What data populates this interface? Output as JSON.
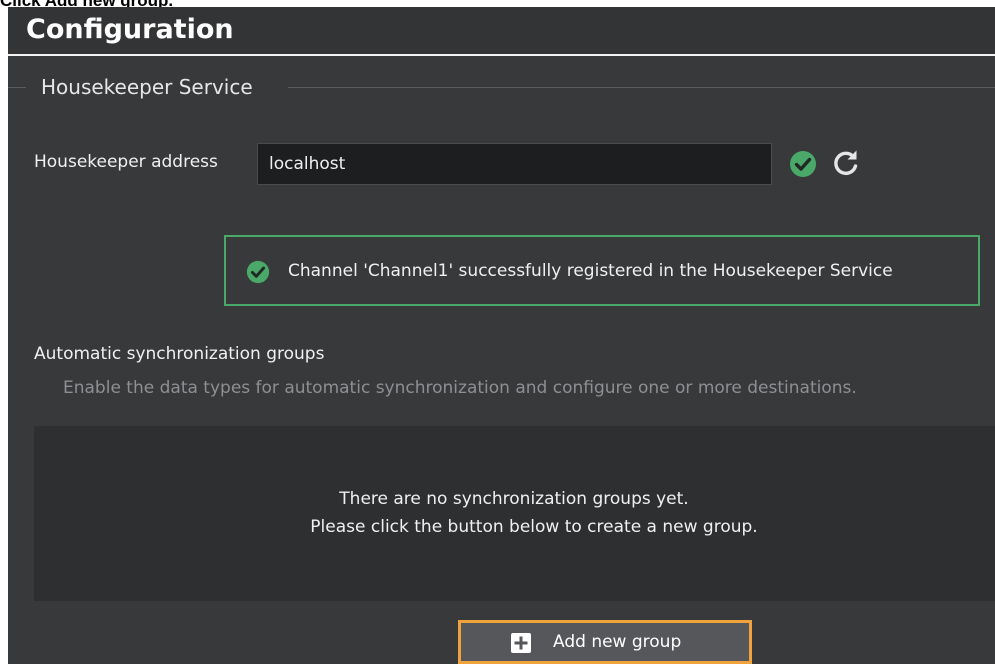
{
  "caption": "Click Add new group.",
  "header": {
    "title": "Configuration"
  },
  "housekeeper": {
    "section_title": "Housekeeper Service",
    "address_label": "Housekeeper address",
    "address_value": "localhost",
    "status_message": "Channel 'Channel1' successfully registered in the Housekeeper Service"
  },
  "sync_groups": {
    "heading": "Automatic synchronization groups",
    "description": "Enable the data types for automatic synchronization and configure one or more destinations.",
    "empty_line1": "There are no synchronization groups yet.",
    "empty_line2": "Please click the button below to create a new group.",
    "add_button_label": "Add new group"
  },
  "colors": {
    "background": "#38393b",
    "success": "#4aa868",
    "highlight": "#f0a23c",
    "input_bg": "#1d1e20"
  },
  "icons": {
    "address_status": "check-circle-icon",
    "refresh": "refresh-icon",
    "status": "check-circle-icon",
    "add": "plus-square-icon"
  }
}
